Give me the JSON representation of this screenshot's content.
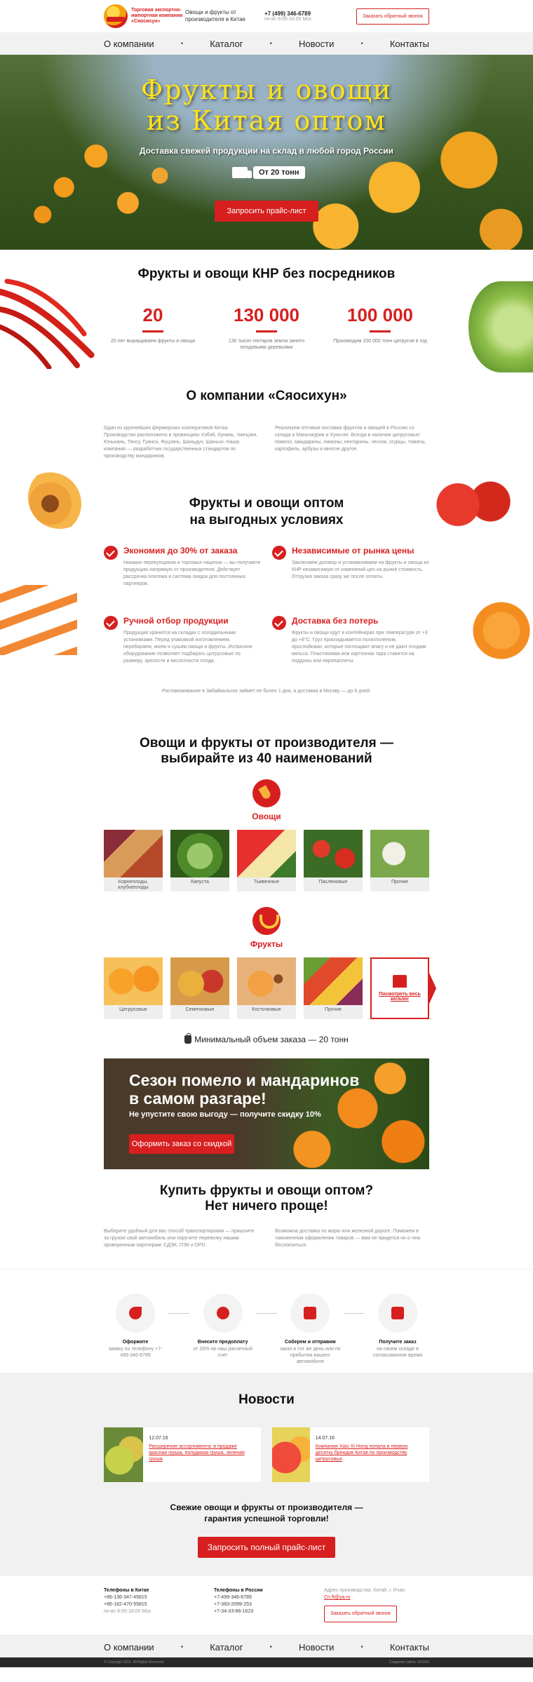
{
  "header": {
    "logo_text": "Торговая экспортно-импортная компания «Сяосихун»",
    "tagline": "Овощи и фрукты от производителя в Китае",
    "phone": "+7 (499) 346-6789",
    "hours": "пн-вс 8:00-18:00 Мск",
    "callback_label": "Заказать обратный звонок"
  },
  "nav": {
    "items": [
      "О компании",
      "Каталог",
      "Новости",
      "Контакты"
    ],
    "separator": "•"
  },
  "hero": {
    "title_line1": "Фрукты и овощи",
    "title_line2": "из Китая оптом",
    "subtitle": "Доставка свежей продукции на склад в любой город России",
    "badge": "От 20 тонн",
    "button": "Запросить прайс-лист"
  },
  "stats": {
    "title": "Фрукты и овощи КНР без посредников",
    "items": [
      {
        "num": "20",
        "desc": "20 лет выращиваем фрукты и овощи"
      },
      {
        "num": "130 000",
        "desc": "130 тысяч гектаров земли занято плодовыми деревьями"
      },
      {
        "num": "100 000",
        "desc": "Производим 100 000 тонн цитрусов в год"
      }
    ]
  },
  "about": {
    "title": "О компании «Сяосихун»",
    "col1": "Один из крупнейших фермерских кооперативов Китая. Производство расположено в провинциях Хэбэй, Хунань, Чжецзян, Юньнань, Тянсу, Гуансн, Фуцзянь, Шаньдун, Шаньси. Наша компания — разработчик государственных стандартов по производству мандаринов.",
    "col2": "Реализуем оптовые поставки фруктов и овощей в Россию со склада в Маньчжурии и Хуньчэн. Всегда в наличии цитрусовые: помело, мандарины, лимоны; нектарины, чеснок, огурцы, томаты, картофель, арбузы и многое другое."
  },
  "advantages": {
    "title_line1": "Фрукты и овощи оптом",
    "title_line2": "на выгодных условиях",
    "items": [
      {
        "title": "Экономия до 30% от заказа",
        "text": "Никаких перекупщиков и торговых наценок — вы получаете продукцию напрямую от производителя. Действует рассрочка платежа и система скидок для постоянных партнеров."
      },
      {
        "title": "Независимые от рынка цены",
        "text": "Заключаем договор и устанавливаем на фрукты и овощи из КНР независимую от изменений цен на рынке стоимость. Отгрузка заказа сразу же после оплаты."
      },
      {
        "title": "Ручной отбор продукции",
        "text": "Продукция хранится на складах с холодильными установками. Перед упаковкой изготовлением, перебираем, моем и сушим овощи и фрукты. Испанское оборудование позволяет подбирать цитрусовые по размеру, зрелости и кислотности плода."
      },
      {
        "title": "Доставка без потерь",
        "text": "Фрукты и овощи едут в контейнерах при температуре от +3 до +8°С. Груз прокладывается полиэтиленом, прослойками, которые поглощают влагу и не дают плодам мяться. Пластиковая или картонная тара ставится на поддоны или европаллеты."
      }
    ],
    "note": "Растаможивание в Забайкальске займет не более 1 дня, а доставка в Москву — до 8 дней."
  },
  "products": {
    "title_line1": "Овощи и фрукты от производителя —",
    "title_line2": "выбирайте из 40 наименований",
    "veg_title": "Овощи",
    "veg": [
      "Корнеплоды, клубнеплоды",
      "Капуста",
      "Тыквенные",
      "Пасленовые",
      "Прочие"
    ],
    "fruit_title": "Фрукты",
    "fruit": [
      "Цитрусовые",
      "Семечковые",
      "Косточковые",
      "Прочие"
    ],
    "catalog_link": "Посмотреть весь каталог",
    "min_order": "Минимальный объем заказа — 20 тонн"
  },
  "promo": {
    "title_line1": "Сезон помело и мандаринов",
    "title_line2": "в самом разгаре!",
    "subtitle": "Не упустите свою выгоду — получите скидку 10%",
    "button": "Оформить заказ со скидкой"
  },
  "buy": {
    "title_line1": "Купить фрукты и овощи оптом?",
    "title_line2": "Нет ничего проще!",
    "col1": "Выберите удобный для вас способ транспортировки — пришлите за грузом свой автомобиль или поручите перевозку нашим проверенным партнерам: СДЭК, ПЭК и DPD.",
    "col2": "Возможна доставка по морю или железной дороге. Поможем в таможенном оформлении товаров — вам не придется ни о чем беспокоиться."
  },
  "steps": [
    {
      "title": "Оформите",
      "text": "заявку по телефону +7-499-346-6789"
    },
    {
      "title": "Внесите предоплату",
      "text": "от 20% на наш расчетный счет"
    },
    {
      "title": "Соберем и отправим",
      "text": "заказ в тот же день или по прибытии вашего автомобиля"
    },
    {
      "title": "Получите заказ",
      "text": "на своем складе в согласованное время"
    }
  ],
  "news": {
    "title": "Новости",
    "items": [
      {
        "date": "12.07.16",
        "text": "Расширение ассортимента: в продаже красная груша, полудикая груша, зеленая груша"
      },
      {
        "date": "14.07.16",
        "text": "Компания Xiao Xi Hong попала в первую десятку брендов Китая по производству цитрусовых"
      }
    ],
    "cta_line1": "Свежие овощи и фрукты от производителя —",
    "cta_line2": "гарантия успешной торговли!",
    "button": "Запросить полный прайс-лист"
  },
  "footer": {
    "china_title": "Телефоны в Китае",
    "china_phones": [
      "+86-136-347-45815",
      "+86-182-470-55815"
    ],
    "china_hours": "пн-вс 8:00-18:00 Мск",
    "russia_title": "Телефоны в России",
    "russia_phones": [
      "+7-499-346-6789",
      "+7-383-2099-253",
      "+7-34-33-86-1623"
    ],
    "address": "Адрес производства: Китай, г. Ичан",
    "email": "Cn.ft@ya.ru",
    "callback_label": "Заказать обратный звонок",
    "copyright": "© Copyright 2016. All Rights Reserved",
    "dev": "Создание сайта: VEGAS"
  },
  "colors": {
    "accent": "#d71f1f",
    "hero_title": "#ffe21a"
  }
}
